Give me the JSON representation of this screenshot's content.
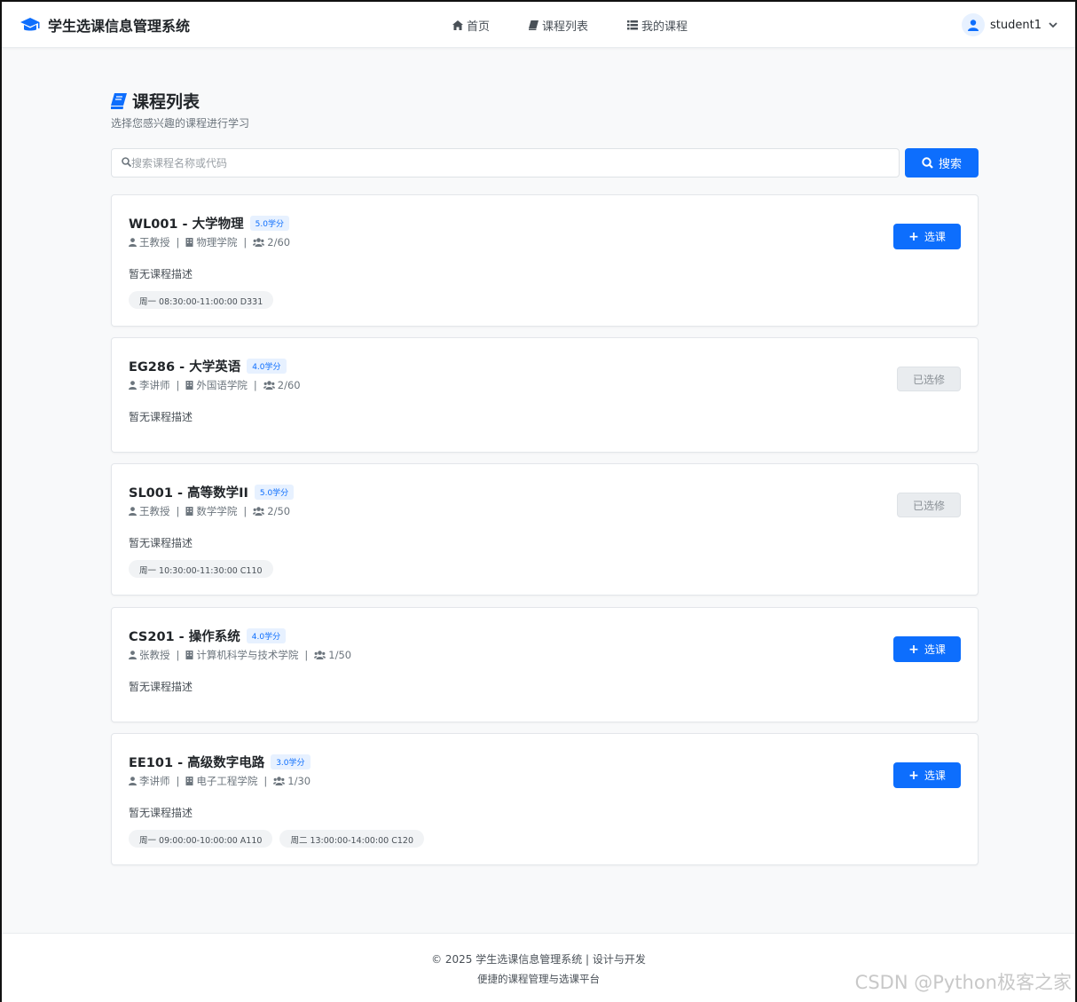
{
  "brand": {
    "title": "学生选课信息管理系统"
  },
  "nav": {
    "home": "首页",
    "courses": "课程列表",
    "my_courses": "我的课程"
  },
  "user": {
    "name": "student1"
  },
  "page": {
    "title": "课程列表",
    "subtitle": "选择您感兴趣的课程进行学习"
  },
  "search": {
    "placeholder": "搜索课程名称或代码",
    "value": "",
    "button": "搜索"
  },
  "courses": [
    {
      "title": "WL001 - 大学物理",
      "credit": "5.0学分",
      "teacher": "王教授",
      "college": "物理学院",
      "enrollment": "2/60",
      "description": "暂无课程描述",
      "schedules": [
        "周一 08:30:00-11:00:00 D331"
      ],
      "action": "选课",
      "selected": false
    },
    {
      "title": "EG286 - 大学英语",
      "credit": "4.0学分",
      "teacher": "李讲师",
      "college": "外国语学院",
      "enrollment": "2/60",
      "description": "暂无课程描述",
      "schedules": [],
      "action": "已选修",
      "selected": true
    },
    {
      "title": "SL001 - 高等数学II",
      "credit": "5.0学分",
      "teacher": "王教授",
      "college": "数学学院",
      "enrollment": "2/50",
      "description": "暂无课程描述",
      "schedules": [
        "周一 10:30:00-11:30:00 C110"
      ],
      "action": "已选修",
      "selected": true
    },
    {
      "title": "CS201 - 操作系统",
      "credit": "4.0学分",
      "teacher": "张教授",
      "college": "计算机科学与技术学院",
      "enrollment": "1/50",
      "description": "暂无课程描述",
      "schedules": [],
      "action": "选课",
      "selected": false
    },
    {
      "title": "EE101 - 高级数字电路",
      "credit": "3.0学分",
      "teacher": "李讲师",
      "college": "电子工程学院",
      "enrollment": "1/30",
      "description": "暂无课程描述",
      "schedules": [
        "周一 09:00:00-10:00:00 A110",
        "周二 13:00:00-14:00:00 C120"
      ],
      "action": "选课",
      "selected": false
    }
  ],
  "footer": {
    "line1": "© 2025 学生选课信息管理系统 | 设计与开发",
    "line2": "便捷的课程管理与选课平台"
  },
  "watermark": "CSDN @Python极客之家",
  "colors": {
    "primary": "#0d6efd",
    "background": "#f8f9fa",
    "badge_bg": "#e7f1ff"
  }
}
